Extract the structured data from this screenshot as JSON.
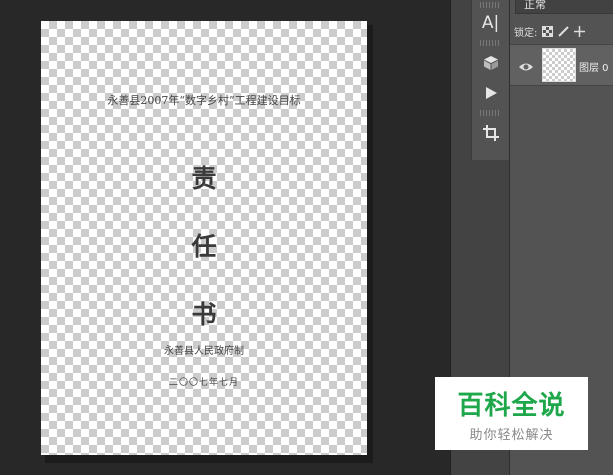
{
  "document": {
    "title": "永善县2007年“数字乡村”工程建设目标",
    "big_chars": [
      "责",
      "任",
      "书"
    ],
    "issuer": "永善县人民政府制",
    "date": "二〇〇七年七月"
  },
  "tools": {
    "character_tool_label": "A|",
    "icons": [
      "character-panel-icon",
      "3d-cube-icon",
      "play-icon",
      "crop-icon"
    ]
  },
  "layers_panel": {
    "blend_mode": "正常",
    "lock_label": "锁定:",
    "layer": {
      "name": "图层 0",
      "visible": true
    }
  },
  "watermark": {
    "main": "百科全说",
    "sub": "助你轻松解决"
  },
  "colors": {
    "workspace_bg": "#282828",
    "panel_bg": "#535353",
    "watermark_green": "#1fa84b"
  }
}
